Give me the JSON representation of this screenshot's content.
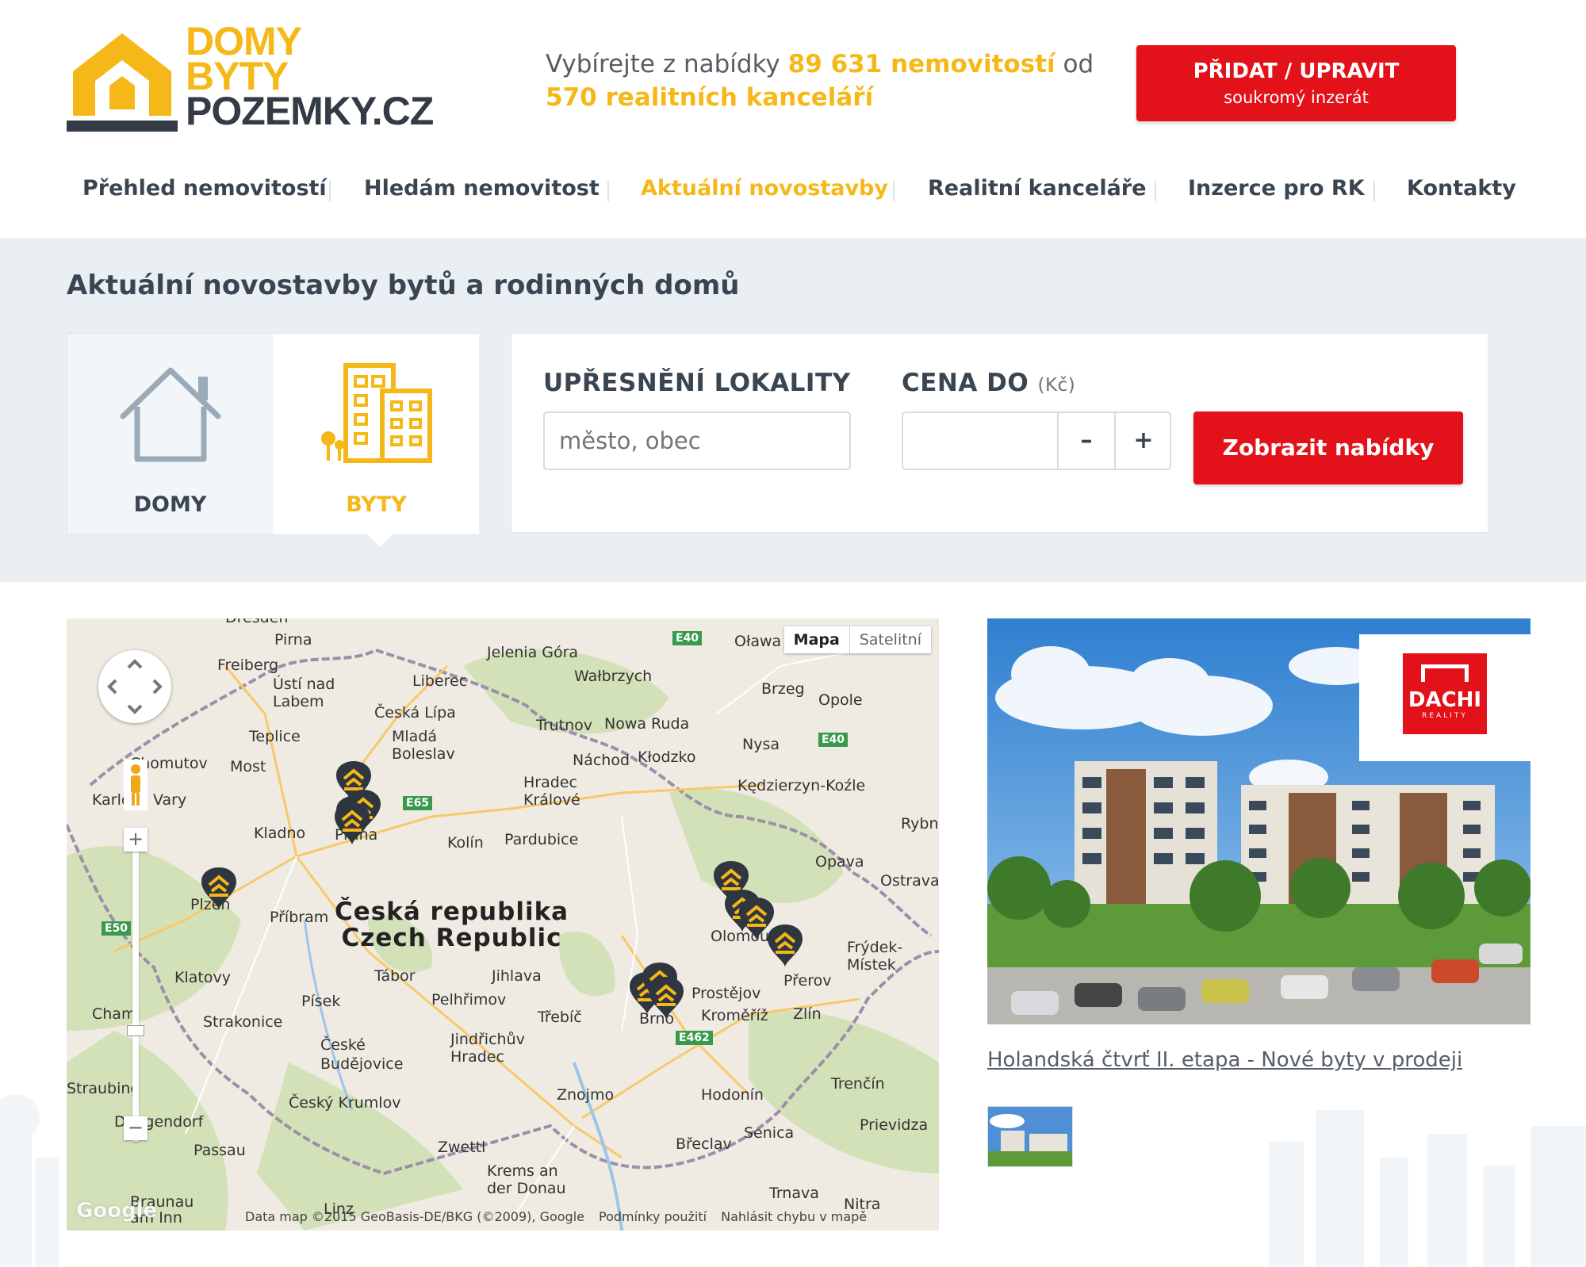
{
  "logo": {
    "line1": "DOMY",
    "line2": "BYTY",
    "line3": "POZEMKY.CZ"
  },
  "tagline": {
    "part1": "Vybírejte z nabídky ",
    "count1": "89 631 nemovitostí",
    "part2": " od",
    "count2": "570 realitních kanceláří"
  },
  "add_button": {
    "line1": "PŘIDAT / UPRAVIT",
    "line2": "soukromý inzerát"
  },
  "nav": {
    "items": [
      {
        "label": "Přehled nemovitostí"
      },
      {
        "label": "Hledám nemovitost"
      },
      {
        "label": "Aktuální novostavby"
      },
      {
        "label": "Realitní kanceláře"
      },
      {
        "label": "Inzerce pro RK"
      },
      {
        "label": "Kontakty"
      }
    ],
    "active": "Aktuální novostavby"
  },
  "page_title": "Aktuální novostavby bytů a rodinných domů",
  "types": {
    "domy": "DOMY",
    "byty": "BYTY",
    "selected": "BYTY"
  },
  "filter": {
    "location_label": "UPŘESNĚNÍ LOKALITY",
    "location_placeholder": "město, obec",
    "price_label": "CENA DO",
    "price_unit": "(Kč)",
    "price_value": "",
    "minus": "–",
    "plus": "+",
    "submit": "Zobrazit nabídky"
  },
  "map": {
    "type_map": "Mapa",
    "type_satellite": "Satelitní",
    "selected_type": "Mapa",
    "google": "Google",
    "attribution": "Data map ©2015 GeoBasis-DE/BKG (©2009), Google",
    "terms": "Podmínky použití",
    "report": "Nahlásit chybu v mapě",
    "country_cs": "Česká republika",
    "country_en": "Czech Republic",
    "cities": [
      "Dresden",
      "Pirna",
      "Freiberg",
      "Ústí nad Labem",
      "Liberec",
      "Jelenia Góra",
      "Wałbrzych",
      "Oława",
      "Brzeg",
      "Opole",
      "Teplice",
      "Česká Lípa",
      "Mladá Boleslav",
      "Trutnov",
      "Nowa Ruda",
      "Náchod",
      "Kłodzko",
      "Nysa",
      "Chomutov",
      "Most",
      "Karlovy Vary",
      "Hradec Králové",
      "Kędzierzyn-Koźle",
      "Kladno",
      "Praha",
      "Kolín",
      "Pardubice",
      "Rybnik",
      "Opava",
      "Ostrava",
      "Plzeň",
      "Příbram",
      "Frýdek-Místek",
      "Klatovy",
      "Tábor",
      "Jihlava",
      "Prostějov",
      "Přerov",
      "Olomouc",
      "Písek",
      "Pelhřimov",
      "Třebíč",
      "Kroměříž",
      "Zlín",
      "Brno",
      "Strakonice",
      "České Budějovice",
      "Jindřichův Hradec",
      "Znojmo",
      "Hodonín",
      "Trenčín",
      "Straubing",
      "Český Krumlov",
      "Senica",
      "Prievidza",
      "Deggendorf",
      "Passau",
      "Zwettl",
      "Krems an der Donau",
      "Břeclav",
      "Trnava",
      "Nitra",
      "Braunau am Inn",
      "Linz",
      "Cham"
    ],
    "roads": [
      "E40",
      "E40",
      "E65",
      "E50",
      "E462"
    ]
  },
  "promo": {
    "logo_text": "DACHI",
    "logo_sub": "REALITY",
    "title": "Holandská čtvrť II. etapa - Nové byty v prodeji"
  },
  "colors": {
    "brand_yellow": "#f6b818",
    "brand_red": "#e3111a",
    "dark": "#333b46",
    "band": "#eaeff3"
  }
}
